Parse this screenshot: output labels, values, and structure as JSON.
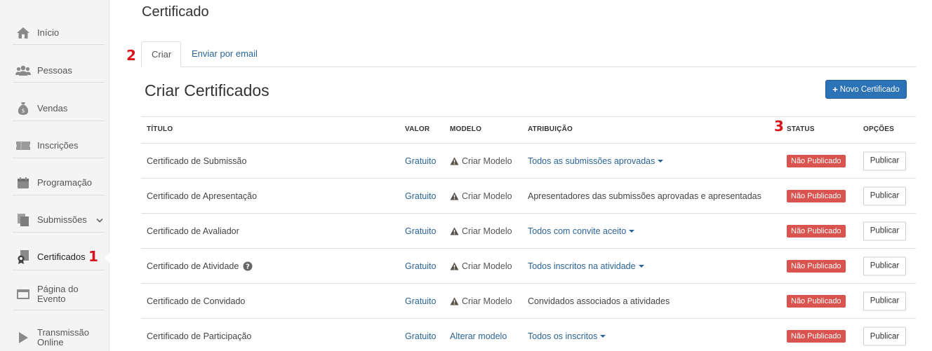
{
  "sidebar": {
    "items": [
      {
        "label": "Início",
        "icon": "home-icon"
      },
      {
        "label": "Pessoas",
        "icon": "people-icon"
      },
      {
        "label": "Vendas",
        "icon": "money-bag-icon"
      },
      {
        "label": "Inscrições",
        "icon": "ticket-icon"
      },
      {
        "label": "Programação",
        "icon": "calendar-icon"
      },
      {
        "label": "Submissões",
        "icon": "documents-icon"
      },
      {
        "label": "Certificados",
        "icon": "certificate-icon"
      },
      {
        "label": "Página do Evento",
        "icon": "window-icon"
      },
      {
        "label": "Transmissão Online",
        "icon": "play-icon"
      }
    ]
  },
  "markers": {
    "one": "1",
    "two": "2",
    "three": "3"
  },
  "page": {
    "title": "Certificado"
  },
  "tabs": {
    "create": "Criar",
    "email": "Enviar por email"
  },
  "section": {
    "title": "Criar Certificados",
    "new_button": "Novo Certificado"
  },
  "table": {
    "headers": {
      "title": "TÍTULO",
      "valor": "VALOR",
      "modelo": "MODELO",
      "atribuicao": "ATRIBUIÇÃO",
      "status": "STATUS",
      "opcoes": "OPÇÕES"
    },
    "rows": [
      {
        "title": "Certificado de Submissão",
        "valor": "Gratuito",
        "modelo": "Criar Modelo",
        "atribuicao": "Todos as submissões aprovadas",
        "status": "Não Publicado",
        "action": "Publicar"
      },
      {
        "title": "Certificado de Apresentação",
        "valor": "Gratuito",
        "modelo": "Criar Modelo",
        "atribuicao": "Apresentadores das submissões aprovadas e apresentadas",
        "status": "Não Publicado",
        "action": "Publicar"
      },
      {
        "title": "Certificado de Avaliador",
        "valor": "Gratuito",
        "modelo": "Criar Modelo",
        "atribuicao": "Todos com convite aceito",
        "status": "Não Publicado",
        "action": "Publicar"
      },
      {
        "title": "Certificado de Atividade",
        "valor": "Gratuito",
        "modelo": "Criar Modelo",
        "atribuicao": "Todos inscritos na atividade",
        "status": "Não Publicado",
        "action": "Publicar"
      },
      {
        "title": "Certificado de Convidado",
        "valor": "Gratuito",
        "modelo": "Criar Modelo",
        "atribuicao": "Convidados associados a atividades",
        "status": "Não Publicado",
        "action": "Publicar"
      },
      {
        "title": "Certificado de Participação",
        "valor": "Gratuito",
        "modelo": "Alterar modelo",
        "atribuicao": "Todos os inscritos",
        "status": "Não Publicado",
        "action": "Publicar"
      }
    ]
  },
  "colors": {
    "primary": "#2b72b6",
    "danger": "#d9534f",
    "link": "#2a6496",
    "marker": "#d9141b"
  }
}
